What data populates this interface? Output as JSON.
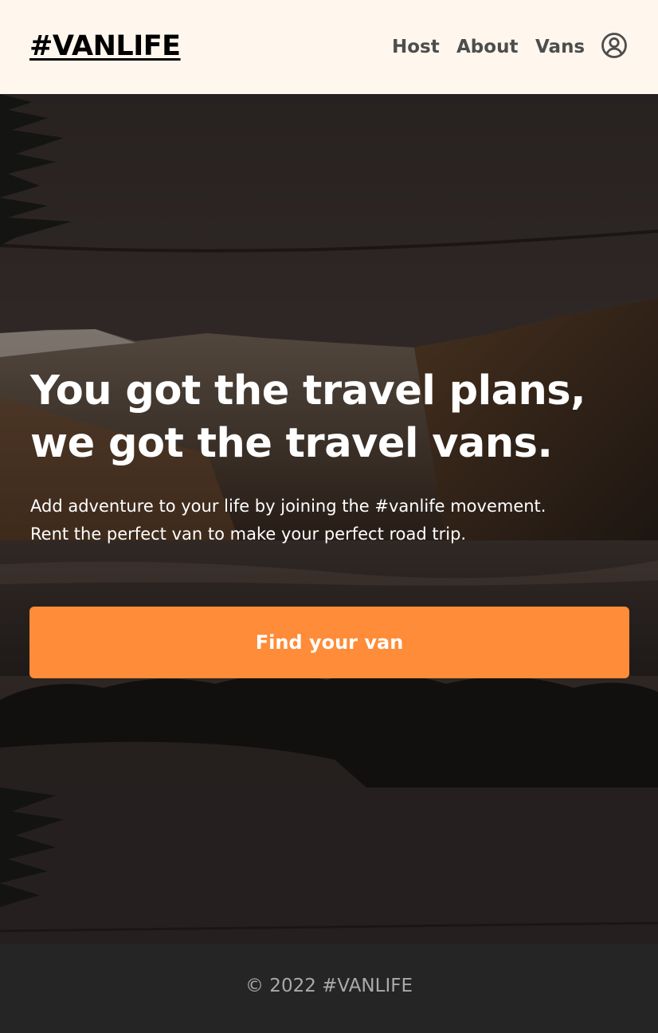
{
  "header": {
    "logo": "#VANLIFE",
    "nav": {
      "host": "Host",
      "about": "About",
      "vans": "Vans"
    },
    "account_icon": "user-circle-icon"
  },
  "hero": {
    "title_line1": "You got the travel plans,",
    "title_line2": "we got the travel vans.",
    "subtitle_line1": "Add adventure to your life by joining the #vanlife movement.",
    "subtitle_line2": "Rent the perfect van to make your perfect road trip.",
    "cta_label": "Find your van"
  },
  "footer": {
    "copyright": "© 2022 #VANLIFE"
  },
  "colors": {
    "header_bg": "#fff7ed",
    "cta": "#ff8c38",
    "footer_bg": "#252525",
    "footer_text": "#aaaaaa",
    "nav_text": "#4d4d4d"
  }
}
